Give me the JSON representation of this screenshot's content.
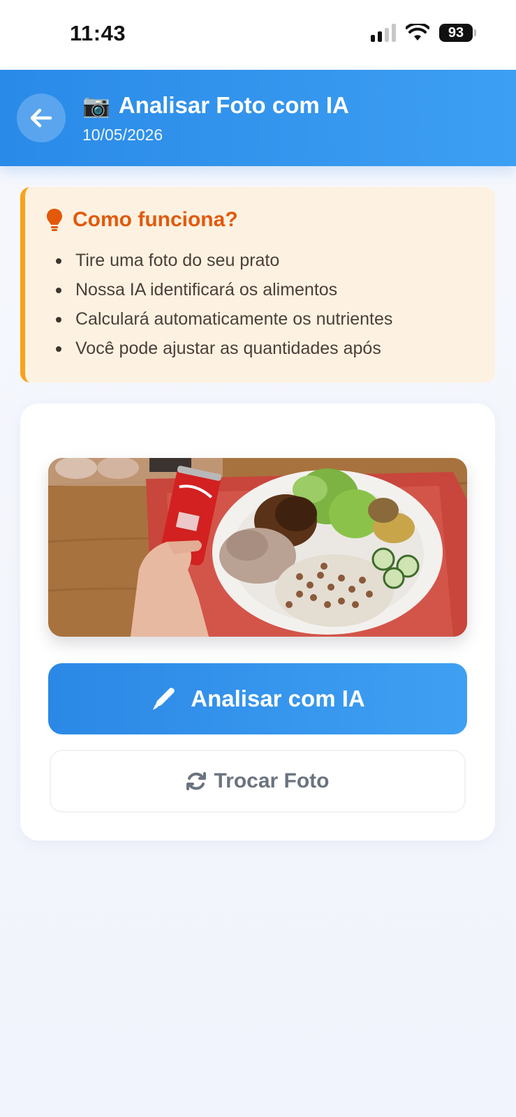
{
  "status_bar": {
    "time": "11:43",
    "battery": "93"
  },
  "header": {
    "icon": "📷",
    "title": "Analisar Foto com IA",
    "date": "10/05/2026"
  },
  "info": {
    "heading": "Como funciona?",
    "items": [
      "Tire uma foto do seu prato",
      "Nossa IA identificará os alimentos",
      "Calculará automaticamente os nutrientes",
      "Você pode ajustar as quantidades após"
    ]
  },
  "actions": {
    "analyze_label": "Analisar com IA",
    "swap_label": "Trocar Foto"
  },
  "colors": {
    "header": "#2a8ae8",
    "info_bg": "#fdf2e1",
    "info_accent": "#f8a21c",
    "info_title": "#e2590c"
  }
}
